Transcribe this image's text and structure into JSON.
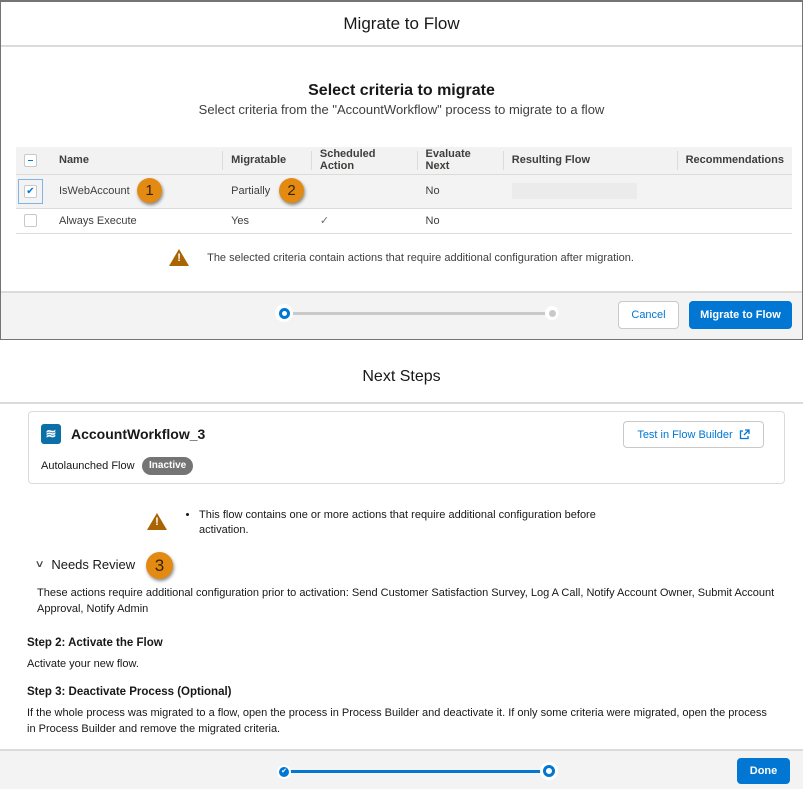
{
  "migrate_modal": {
    "title": "Migrate to Flow",
    "heading": "Select criteria to migrate",
    "subheading": "Select criteria from the \"AccountWorkflow\" process to migrate to a flow",
    "table": {
      "columns": [
        "Name",
        "Migratable",
        "Scheduled Action",
        "Evaluate Next",
        "Resulting Flow",
        "Recommendations"
      ],
      "rows": [
        {
          "selected": true,
          "name": "IsWebAccount",
          "migratable": "Partially",
          "scheduled_action": "",
          "evaluate_next": "No",
          "resulting_flow": "",
          "recommendations": ""
        },
        {
          "selected": false,
          "name": "Always Execute",
          "migratable": "Yes",
          "scheduled_action": "✓",
          "evaluate_next": "No",
          "resulting_flow": "",
          "recommendations": ""
        }
      ]
    },
    "warning": "The selected criteria contain actions that require additional configuration after migration.",
    "progress": {
      "current_step": 1,
      "total_steps": 2
    },
    "cancel_label": "Cancel",
    "migrate_label": "Migrate to Flow"
  },
  "callouts": [
    "1",
    "2",
    "3"
  ],
  "next_steps": {
    "title": "Next Steps",
    "flow": {
      "icon": "flow-icon",
      "name": "AccountWorkflow_3",
      "type": "Autolaunched Flow",
      "status": "Inactive",
      "test_button_label": "Test in Flow Builder"
    },
    "warning_item": "This flow contains one or more actions that require additional configuration before activation.",
    "needs_review": {
      "label": "Needs Review",
      "expanded": true,
      "text": "These actions require additional configuration prior to activation: Send Customer Satisfaction Survey, Log A Call, Notify Account Owner, Submit Account Approval, Notify Admin"
    },
    "steps": [
      {
        "heading": "Step 2: Activate the Flow",
        "text": "Activate your new flow."
      },
      {
        "heading": "Step 3: Deactivate Process (Optional)",
        "text": "If the whole process was migrated to a flow, open the process in Process Builder and deactivate it. If only some criteria were migrated, open the process in Process Builder and remove the migrated criteria."
      }
    ],
    "progress": {
      "current_step": 2,
      "total_steps": 2
    },
    "done_label": "Done"
  },
  "colors": {
    "brand": "#0176d3",
    "warning": "#a96404",
    "callout": "#e38a12",
    "badge_inactive": "#747474"
  }
}
